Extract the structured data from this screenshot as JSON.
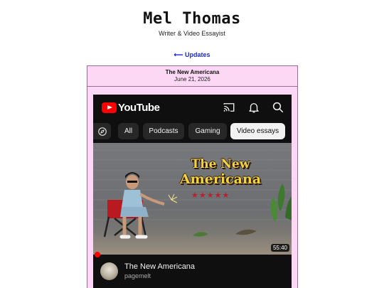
{
  "header": {
    "title": "Mel Thomas",
    "subtitle": "Writer & Video Essayist"
  },
  "nav": {
    "back_arrow": "⟵",
    "back_label": "Updates"
  },
  "post": {
    "title": "The New Americana",
    "date": "June 21, 2026",
    "background": "#fdd8f5",
    "youtube": {
      "logo_text": "YouTube",
      "brand_color": "#ff0000",
      "icons": [
        "cast-icon",
        "bell-icon",
        "search-icon",
        "explore-icon"
      ],
      "chips": [
        {
          "label": "All",
          "active": false
        },
        {
          "label": "Podcasts",
          "active": false
        },
        {
          "label": "Gaming",
          "active": false
        },
        {
          "label": "Video essays",
          "active": true
        }
      ],
      "video": {
        "thumbnail_title_line1": "The New",
        "thumbnail_title_line2": "Americana",
        "rating_stars": 5,
        "duration": "55:40",
        "title": "The New Americana",
        "channel": "pagemelt"
      }
    }
  }
}
